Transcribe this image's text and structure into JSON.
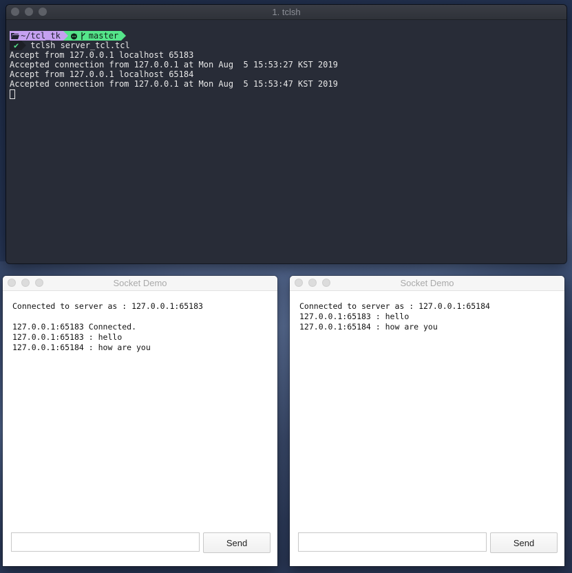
{
  "terminal": {
    "title": "1. tclsh",
    "prompt_path": "~/tcl_tk",
    "prompt_branch": "master",
    "status_icon": "check-icon",
    "command": "tclsh server_tcl.tcl",
    "output": [
      "Accept from 127.0.0.1 localhost 65183",
      "Accepted connection from 127.0.0.1 at Mon Aug  5 15:53:27 KST 2019",
      "Accept from 127.0.0.1 localhost 65184",
      "Accepted connection from 127.0.0.1 at Mon Aug  5 15:53:47 KST 2019"
    ]
  },
  "socket_left": {
    "title": "Socket Demo",
    "lines": [
      "Connected to server as : 127.0.0.1:65183",
      "",
      "127.0.0.1:65183 Connected.",
      "127.0.0.1:65183 : hello",
      "127.0.0.1:65184 : how are you"
    ],
    "input_value": "",
    "send_label": "Send"
  },
  "socket_right": {
    "title": "Socket Demo",
    "lines": [
      "Connected to server as : 127.0.0.1:65184",
      "127.0.0.1:65183 : hello",
      "127.0.0.1:65184 : how are you"
    ],
    "input_value": "",
    "send_label": "Send"
  }
}
